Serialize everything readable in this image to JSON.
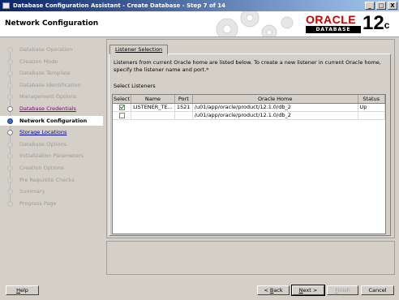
{
  "window": {
    "title": "Database Configuration Assistant - Create Database - Step 7 of 14",
    "controls": [
      "_",
      "□",
      "X"
    ]
  },
  "banner": {
    "heading": "Network Configuration",
    "brand": "ORACLE",
    "product": "DATABASE",
    "version": "12",
    "version_suffix": "c"
  },
  "nav": {
    "items": [
      {
        "label": "Database Operation",
        "state": "pending"
      },
      {
        "label": "Creation Mode",
        "state": "pending"
      },
      {
        "label": "Database Template",
        "state": "pending"
      },
      {
        "label": "Database Identification",
        "state": "pending"
      },
      {
        "label": "Management Options",
        "state": "pending"
      },
      {
        "label": "Database Credentials",
        "state": "visited"
      },
      {
        "label": "Network Configuration",
        "state": "active"
      },
      {
        "label": "Storage Locations",
        "state": "link"
      },
      {
        "label": "Database Options",
        "state": "pending"
      },
      {
        "label": "Initialization Parameters",
        "state": "pending"
      },
      {
        "label": "Creation Options",
        "state": "pending"
      },
      {
        "label": "Pre Requisite Checks",
        "state": "pending"
      },
      {
        "label": "Summary",
        "state": "pending"
      },
      {
        "label": "Progress Page",
        "state": "pending"
      }
    ]
  },
  "panel": {
    "tab": "Listener Selection",
    "description": "Listeners from current Oracle home are listed below. To create a new listener in current Oracle home, specify the listener name and port.*",
    "select_label": "Select Listeners",
    "columns": [
      "Select",
      "Name",
      "Port",
      "Oracle Home",
      "Status"
    ],
    "rows": [
      {
        "selected": true,
        "name": "LISTENER_TE...",
        "port": "1521",
        "home": "/u01/app/oracle/product/12.1.0/db_2",
        "status": "Up"
      },
      {
        "selected": false,
        "name": "",
        "port": "",
        "home": "/u01/app/oracle/product/12.1.0/db_2",
        "status": ""
      }
    ]
  },
  "buttons": {
    "help": {
      "mnemonic": "H",
      "rest": "elp"
    },
    "back": {
      "prefix": "< ",
      "mnemonic": "B",
      "rest": "ack"
    },
    "next": {
      "mnemonic": "N",
      "rest": "ext >"
    },
    "finish": {
      "mnemonic": "F",
      "rest": "inish"
    },
    "cancel": {
      "label": "Cancel"
    }
  }
}
